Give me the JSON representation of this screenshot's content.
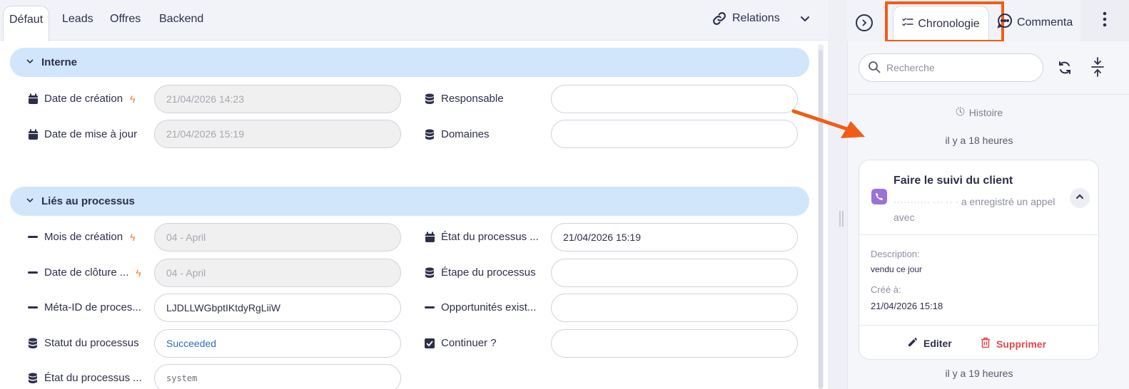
{
  "tabs": [
    {
      "label": "Défaut"
    },
    {
      "label": "Leads"
    },
    {
      "label": "Offres"
    },
    {
      "label": "Backend"
    }
  ],
  "relations": {
    "label": "Relations"
  },
  "sections": [
    {
      "title": "Interne"
    },
    {
      "title": "Liés au processus"
    }
  ],
  "interne": {
    "date_creation": {
      "label": "Date de création",
      "value": "21/04/2026 14:23"
    },
    "date_maj": {
      "label": "Date de mise à jour",
      "value": "21/04/2026 15:19"
    },
    "responsable": {
      "label": "Responsable",
      "value": ""
    },
    "domaines": {
      "label": "Domaines",
      "value": ""
    }
  },
  "processus": {
    "mois_creation": {
      "label": "Mois de création",
      "value": "04 - April"
    },
    "date_cloture": {
      "label": "Date de clôture ...",
      "value": "04 - April"
    },
    "meta_id": {
      "label": "Méta-ID de proces...",
      "value": "LJDLLWGbptIKtdyRgLiiW"
    },
    "statut": {
      "label": "Statut du processus",
      "value": "Succeeded"
    },
    "etat_bas": {
      "label": "État du processus ...",
      "value": "system"
    },
    "etat": {
      "label": "État du processus ...",
      "value": "21/04/2026 15:19"
    },
    "etape": {
      "label": "Étape du processus",
      "value": ""
    },
    "opportunites": {
      "label": "Opportunités exist...",
      "value": ""
    },
    "continuer": {
      "label": "Continuer ?",
      "value": ""
    }
  },
  "right_panel": {
    "chronologie_tab": "Chronologie",
    "commentaires_tab": "Commenta",
    "search_placeholder": "Recherche",
    "histoire": "Histoire",
    "ago_1": "il y a 18 heures",
    "ago_2": "il y a 19 heures",
    "card": {
      "title": "Faire le suivi du client",
      "subtitle_hidden": "··········· ··· ·· ·",
      "subtitle": "a enregistré un appel avec",
      "desc_label": "Description:",
      "desc_value": "vendu ce jour",
      "created_label": "Créé à:",
      "created_value": "21/04/2026 15:18",
      "edit_label": "Editer",
      "delete_label": "Supprimer"
    }
  },
  "colors": {
    "accent_highlight": "#f25c17",
    "section_bg": "#d2e6fb",
    "delete_red": "#e5484d",
    "link_blue": "#2f6cc1",
    "bolt_orange": "#f27a2d",
    "phone_purple": "#9b72d8"
  }
}
